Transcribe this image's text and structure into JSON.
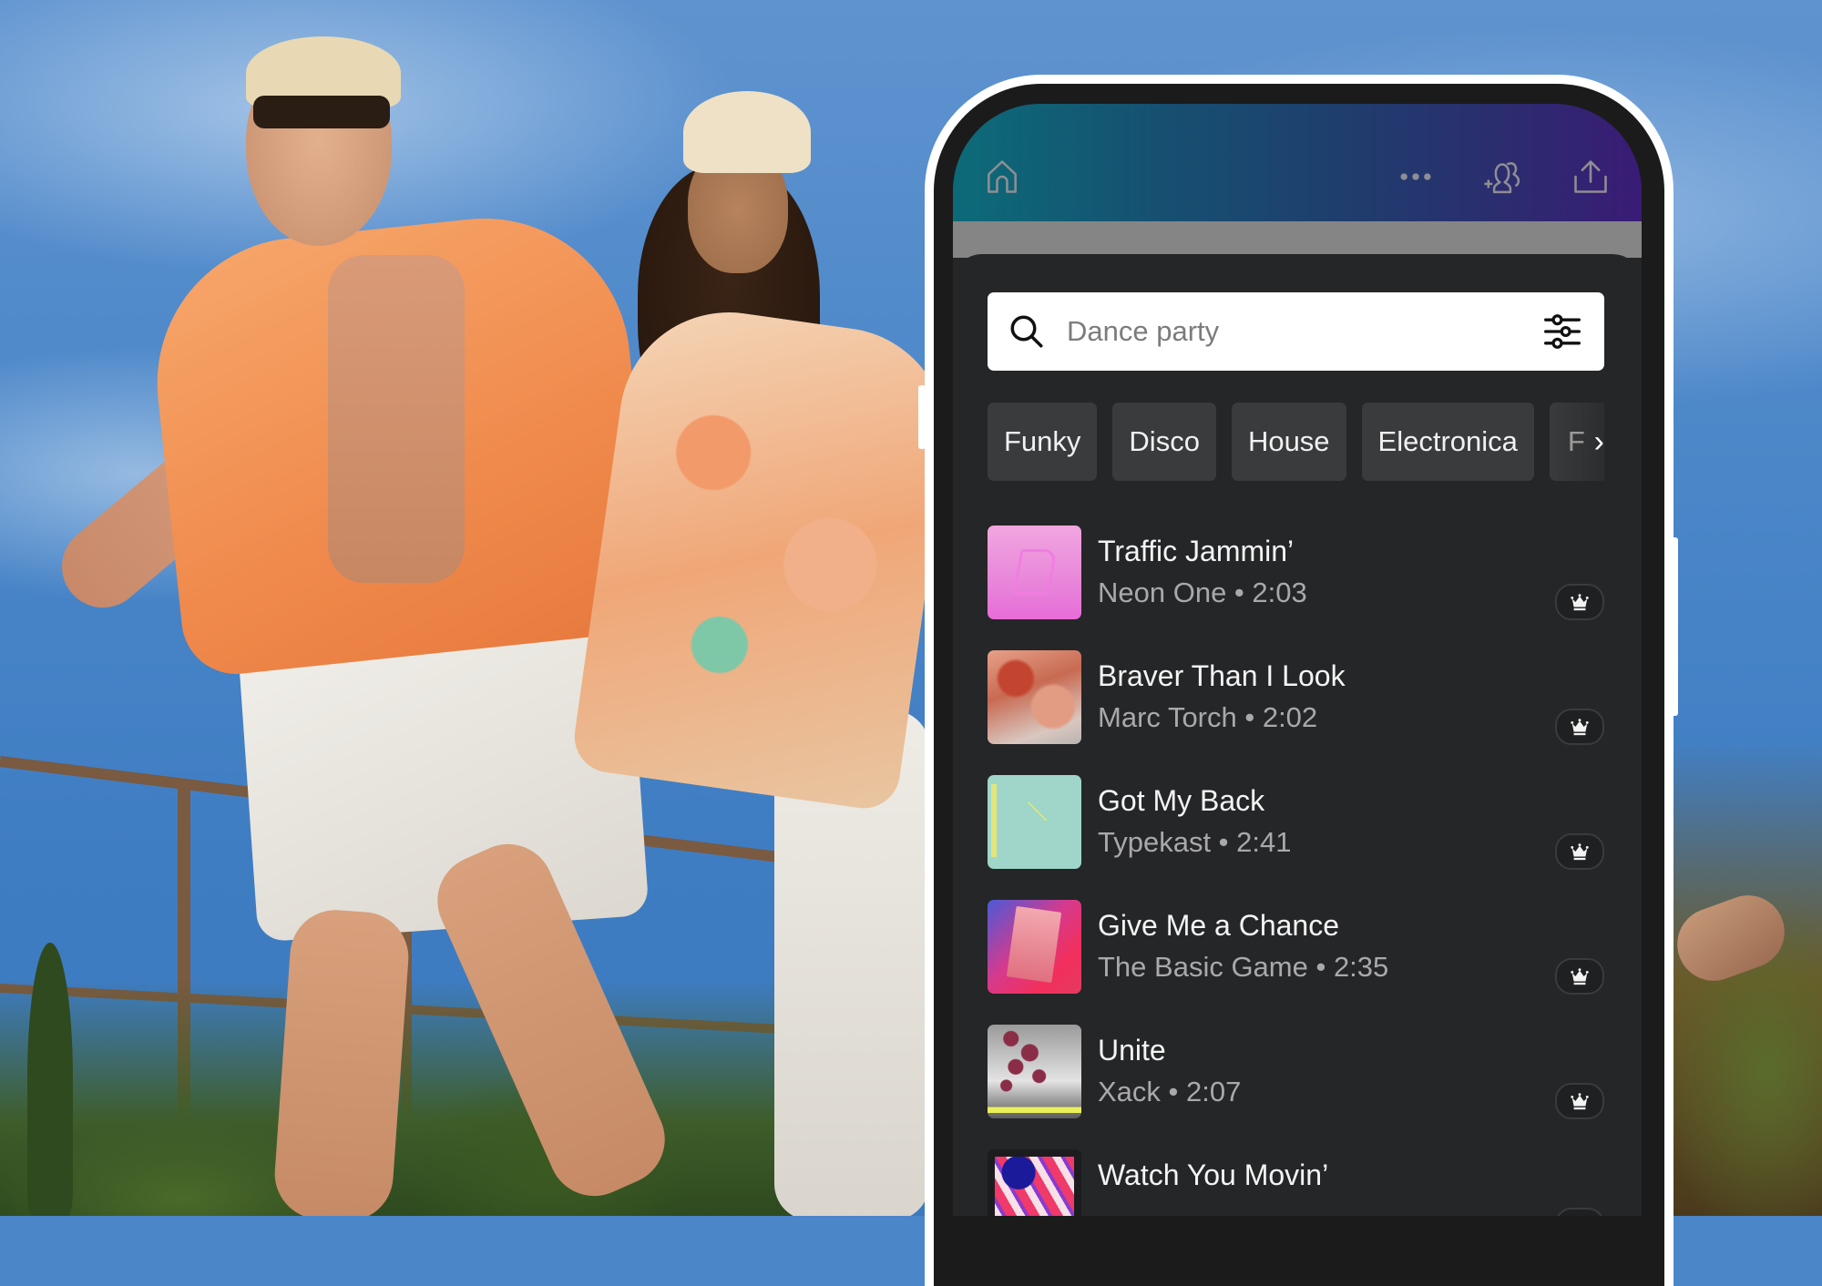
{
  "background": {
    "description": "Two people in summer outfits posing outdoors under a blue sky with trees and a railing"
  },
  "app": {
    "topbar": {
      "home_icon": "home-icon",
      "more_icon": "more-horizontal-icon",
      "add_people_icon": "add-people-icon",
      "share_icon": "share-upload-icon"
    },
    "search": {
      "placeholder": "Dance party",
      "value": "",
      "search_icon": "search-icon",
      "filter_icon": "filter-sliders-icon"
    },
    "chips": [
      {
        "label": "Funky"
      },
      {
        "label": "Disco"
      },
      {
        "label": "House"
      },
      {
        "label": "Electronica"
      },
      {
        "label": "F"
      }
    ],
    "chips_more_icon": "chevron-right-icon",
    "tracks": [
      {
        "title": "Traffic Jammin’",
        "artist": "Neon One",
        "duration": "2:03",
        "subtitle": "Neon One • 2:03",
        "badge": "crown-icon"
      },
      {
        "title": "Braver Than I Look",
        "artist": "Marc Torch",
        "duration": "2:02",
        "subtitle": "Marc Torch • 2:02",
        "badge": "crown-icon"
      },
      {
        "title": "Got My Back",
        "artist": "Typekast",
        "duration": "2:41",
        "subtitle": "Typekast • 2:41",
        "badge": "crown-icon"
      },
      {
        "title": "Give Me a Chance",
        "artist": "The Basic Game",
        "duration": "2:35",
        "subtitle": "The Basic Game • 2:35",
        "badge": "crown-icon"
      },
      {
        "title": "Unite",
        "artist": "Xack",
        "duration": "2:07",
        "subtitle": "Xack • 2:07",
        "badge": "crown-icon"
      },
      {
        "title": "Watch You Movin’",
        "artist": "",
        "duration": "",
        "subtitle": "",
        "badge": "crown-icon"
      }
    ]
  },
  "colors": {
    "topbar_gradient_start": "#0c6b78",
    "topbar_gradient_end": "#3a1b76",
    "panel_bg": "#252628",
    "chip_bg": "#3a3b3d",
    "title_text": "#f4f4f4",
    "subtitle_text": "#a9a9ad"
  }
}
